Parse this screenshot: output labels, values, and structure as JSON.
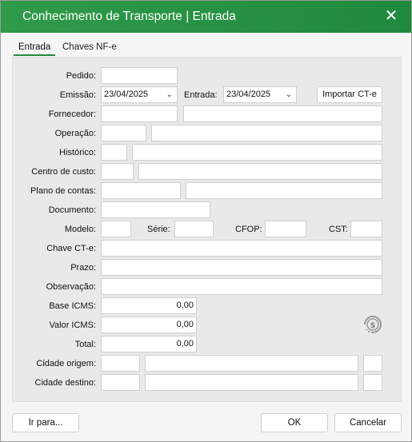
{
  "window": {
    "title": "Conhecimento de Transporte | Entrada",
    "close_symbol": "✕"
  },
  "tabs": [
    {
      "label": "Entrada"
    },
    {
      "label": "Chaves NF-e"
    }
  ],
  "form": {
    "pedido_label": "Pedido:",
    "emissao_label": "Emissão:",
    "emissao_value": "23/04/2025",
    "entrada_label": "Entrada:",
    "entrada_value": "23/04/2025",
    "importar_button": "Importar CT-e",
    "fornecedor_label": "Fornecedor:",
    "operacao_label": "Operação:",
    "historico_label": "Histórico:",
    "centro_label": "Centro de custo:",
    "plano_label": "Plano de contas:",
    "documento_label": "Documento:",
    "modelo_label": "Modelo:",
    "serie_label": "Série:",
    "cfop_label": "CFOP:",
    "cst_label": "CST:",
    "chave_label": "Chave CT-e:",
    "prazo_label": "Prazo:",
    "observacao_label": "Observação:",
    "base_icms_label": "Base ICMS:",
    "base_icms_value": "0,00",
    "valor_icms_label": "Valor ICMS:",
    "valor_icms_value": "0,00",
    "total_label": "Total:",
    "total_value": "0,00",
    "origem_label": "Cidade origem:",
    "destino_label": "Cidade destino:"
  },
  "footer": {
    "ir_para": "Ir para...",
    "ok": "OK",
    "cancelar": "Cancelar"
  }
}
